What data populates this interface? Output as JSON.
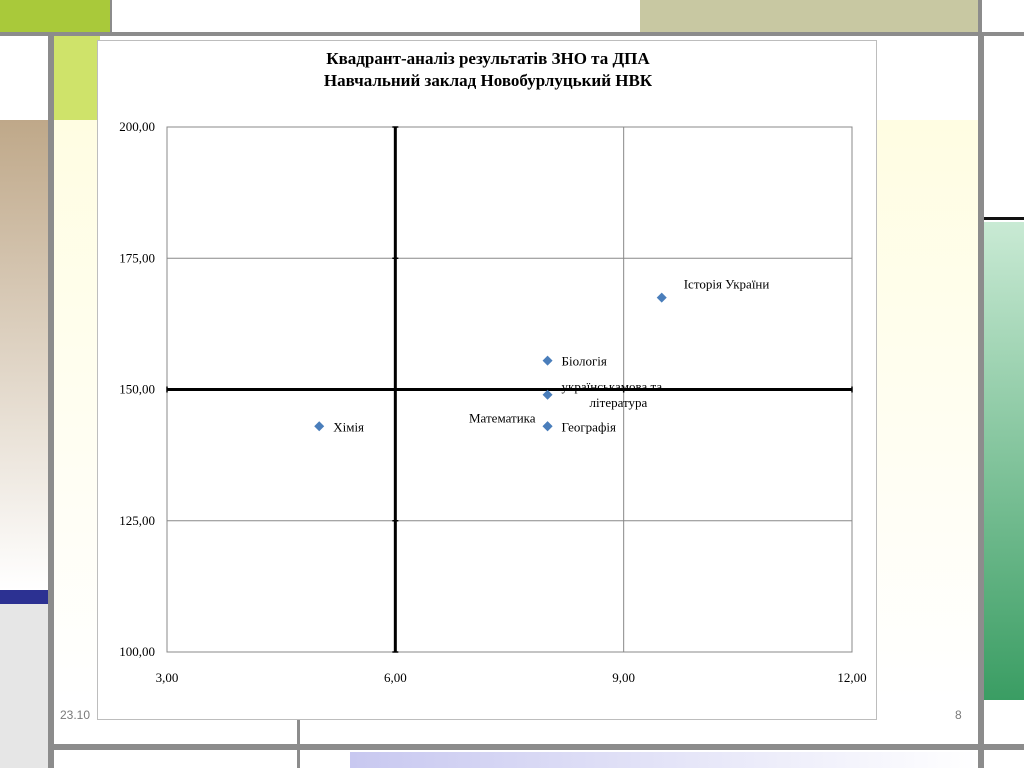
{
  "slide": {
    "date_text": "23.10",
    "page_number": "8",
    "colors": {
      "left_band_gradient_top": "#bfa889",
      "accent_green": "#3a9d63",
      "accent_lime": "#cfe36a",
      "accent_olive": "#c8c8a2",
      "accent_navy": "#2c3192",
      "frame_gray": "#8c8c8c",
      "yellow_bg": "#fffde2"
    }
  },
  "chart_data": {
    "type": "scatter",
    "title_line1": "Квадрант-аналіз результатів ЗНО та ДПА",
    "title_line2": "Навчальний заклад  Новобурлуцький НВК",
    "xlabel": "",
    "ylabel": "",
    "xlim": [
      3,
      12
    ],
    "ylim": [
      100,
      200
    ],
    "x_ticks": [
      3,
      6,
      9,
      12
    ],
    "y_ticks": [
      100,
      125,
      150,
      175,
      200
    ],
    "x_tick_labels": [
      "3,00",
      "6,00",
      "9,00",
      "12,00"
    ],
    "y_tick_labels": [
      "100,00",
      "125,00",
      "150,00",
      "175,00",
      "200,00"
    ],
    "grid": true,
    "quadrant_lines": {
      "x": 6,
      "y": 150
    },
    "marker_color": "#4a7ebb",
    "points": [
      {
        "label": "Хімія",
        "x": 5.0,
        "y": 143,
        "label_pos": "right"
      },
      {
        "label": "Біологія",
        "x": 8.0,
        "y": 155.5,
        "label_pos": "right"
      },
      {
        "label": "українська мова та література",
        "x": 8.0,
        "y": 149,
        "label_pos": "right-2line",
        "label_lines": [
          "українськамова та",
          "література"
        ]
      },
      {
        "label": "Математика",
        "x": 8.0,
        "y": 143,
        "label_pos": "left-above"
      },
      {
        "label": "Географія",
        "x": 8.0,
        "y": 143,
        "label_pos": "right"
      },
      {
        "label": "Історія України",
        "x": 9.5,
        "y": 167.5,
        "label_pos": "right-above"
      }
    ]
  }
}
